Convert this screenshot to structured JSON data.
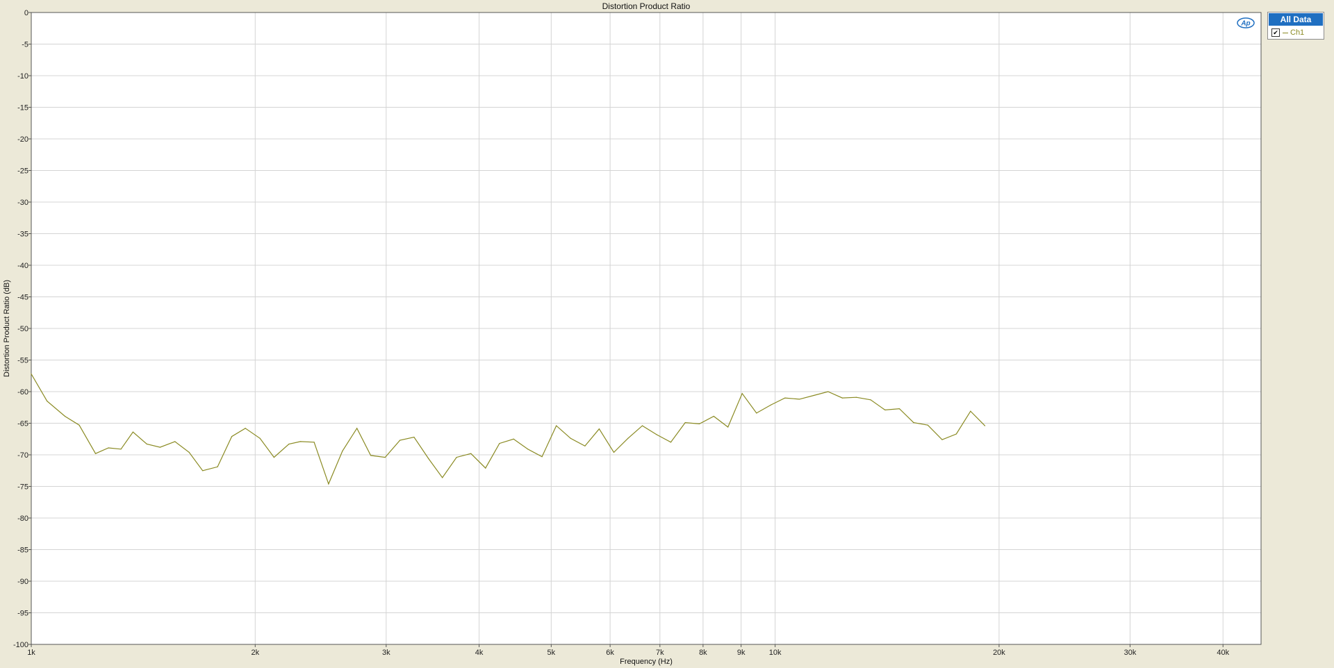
{
  "chart_data": {
    "type": "line",
    "title": "Distortion Product Ratio",
    "xlabel": "Frequency (Hz)",
    "ylabel": "Distortion Product Ratio (dB)",
    "x_scale": "log",
    "xlim": [
      1000,
      45000
    ],
    "ylim": [
      -100,
      0
    ],
    "grid": true,
    "legend_position": "right",
    "x_ticks": [
      {
        "value": 1000,
        "label": "1k"
      },
      {
        "value": 2000,
        "label": "2k"
      },
      {
        "value": 3000,
        "label": "3k"
      },
      {
        "value": 4000,
        "label": "4k"
      },
      {
        "value": 5000,
        "label": "5k"
      },
      {
        "value": 6000,
        "label": "6k"
      },
      {
        "value": 7000,
        "label": "7k"
      },
      {
        "value": 8000,
        "label": "8k"
      },
      {
        "value": 9000,
        "label": "9k"
      },
      {
        "value": 10000,
        "label": "10k"
      },
      {
        "value": 20000,
        "label": "20k"
      },
      {
        "value": 30000,
        "label": "30k"
      },
      {
        "value": 40000,
        "label": "40k"
      }
    ],
    "y_ticks": [
      0,
      -5,
      -10,
      -15,
      -20,
      -25,
      -30,
      -35,
      -40,
      -45,
      -50,
      -55,
      -60,
      -65,
      -70,
      -75,
      -80,
      -85,
      -90,
      -95,
      -100
    ],
    "series": [
      {
        "name": "Ch1",
        "color": "#8a8a22",
        "x": [
          1000,
          1050,
          1110,
          1160,
          1220,
          1270,
          1320,
          1370,
          1430,
          1490,
          1560,
          1630,
          1700,
          1780,
          1860,
          1940,
          2030,
          2120,
          2220,
          2300,
          2400,
          2510,
          2620,
          2740,
          2860,
          2990,
          3130,
          3270,
          3420,
          3570,
          3730,
          3900,
          4080,
          4260,
          4450,
          4650,
          4860,
          5080,
          5310,
          5550,
          5800,
          6070,
          6340,
          6630,
          6930,
          7240,
          7570,
          7910,
          8270,
          8640,
          9030,
          9440,
          9870,
          10310,
          10780,
          11270,
          11780,
          12310,
          12860,
          13440,
          14050,
          14690,
          15350,
          16040,
          16770,
          17520,
          18310,
          19140
        ],
        "y": [
          -57.2,
          -61.5,
          -63.9,
          -65.3,
          -69.8,
          -68.9,
          -69.1,
          -66.4,
          -68.3,
          -68.8,
          -67.9,
          -69.6,
          -72.5,
          -71.9,
          -67.1,
          -65.8,
          -67.4,
          -70.4,
          -68.3,
          -67.9,
          -68.0,
          -74.6,
          -69.4,
          -65.8,
          -70.1,
          -70.4,
          -67.7,
          -67.2,
          -70.6,
          -73.6,
          -70.4,
          -69.8,
          -72.1,
          -68.2,
          -67.5,
          -69.1,
          -70.3,
          -65.4,
          -67.4,
          -68.6,
          -65.9,
          -69.6,
          -67.4,
          -65.4,
          -66.8,
          -68.0,
          -64.9,
          -65.1,
          -63.9,
          -65.6,
          -60.3,
          -63.4,
          -62.1,
          -61.0,
          -61.2,
          -60.6,
          -60.0,
          -61.0,
          -60.9,
          -61.3,
          -62.9,
          -62.7,
          -64.9,
          -65.3,
          -67.6,
          -66.7,
          -63.1,
          -65.4
        ],
        "y_note": ""
      }
    ]
  },
  "legend": {
    "header": "All Data",
    "items": [
      {
        "label": "Ch1",
        "checked": true
      }
    ]
  },
  "logo_text": "Ap"
}
